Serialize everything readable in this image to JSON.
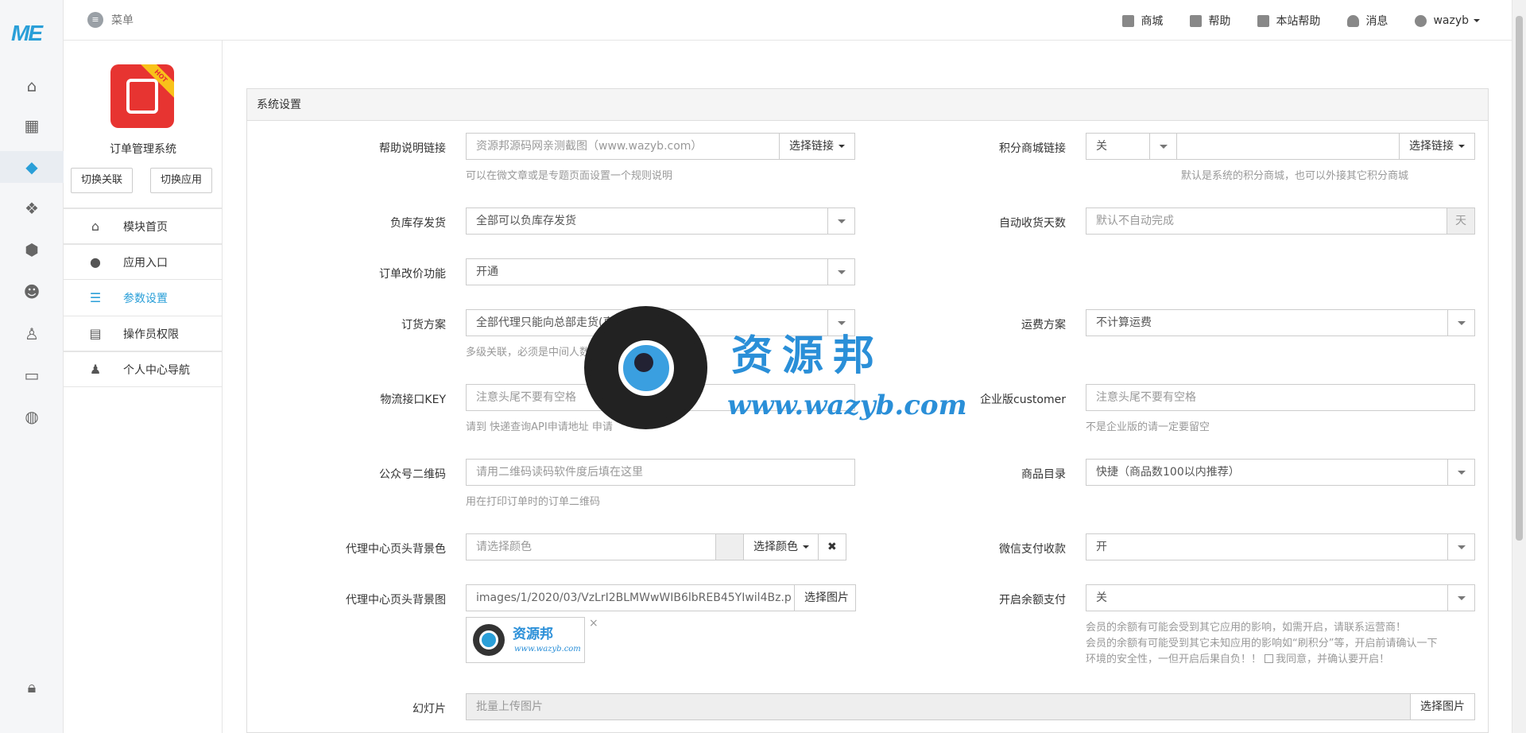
{
  "brand": {
    "logo_text": "ME"
  },
  "topbar": {
    "menu_label": "菜单",
    "links": [
      "商城",
      "帮助",
      "本站帮助",
      "消息"
    ],
    "username": "wazyb"
  },
  "sidebar": {
    "app_name": "订单管理系统",
    "ribbon": "HOT",
    "buttons": [
      "切换关联",
      "切换应用"
    ],
    "items": [
      "模块首页",
      "应用入口",
      "参数设置",
      "操作员权限",
      "个人中心导航"
    ]
  },
  "panel": {
    "title": "系统设置",
    "select_link": "选择链接",
    "select_color": "选择颜色",
    "select_image": "选择图片",
    "help_link": {
      "label": "帮助说明链接",
      "value": "资源邦源码网亲测截图（www.wazyb.com）",
      "help": "可以在微文章或是专题页面设置一个规则说明"
    },
    "points_mall": {
      "label": "积分商城链接",
      "value": "关",
      "help": "默认是系统的积分商城，也可以外接其它积分商城"
    },
    "negative_stock": {
      "label": "负库存发货",
      "value": "全部可以负库存发货"
    },
    "auto_receive": {
      "label": "自动收货天数",
      "placeholder": "默认不自动完成",
      "unit": "天"
    },
    "price_change": {
      "label": "订单改价功能",
      "value": "开通"
    },
    "order_plan": {
      "label": "订货方案",
      "value": "全部代理只能向总部走货(直接",
      "help": "多级关联，必须是中间人数据，不能"
    },
    "freight": {
      "label": "运费方案",
      "value": "不计算运费"
    },
    "logistics_key": {
      "label": "物流接口KEY",
      "placeholder": "注意头尾不要有空格",
      "help": "请到 快递查询API申请地址 申请"
    },
    "enterprise": {
      "label": "企业版customer",
      "placeholder": "注意头尾不要有空格",
      "help": "不是企业版的请一定要留空"
    },
    "qrcode": {
      "label": "公众号二维码",
      "placeholder": "请用二维码读码软件度后填在这里",
      "help": "用在打印订单时的订单二维码"
    },
    "catalog": {
      "label": "商品目录",
      "value": "快捷（商品数100以内推荐）"
    },
    "header_bg_color": {
      "label": "代理中心页头背景色",
      "placeholder": "请选择颜色",
      "clear": "✖"
    },
    "wechat_pay": {
      "label": "微信支付收款",
      "value": "开"
    },
    "header_bg_image": {
      "label": "代理中心页头背景图",
      "value": "images/1/2020/03/VzLrI2BLMWwWIB6lbREB45YIwil4Bz.p",
      "thumb_title": "资源邦",
      "thumb_url": "www.wazyb.com",
      "remove": "×"
    },
    "balance_pay": {
      "label": "开启余额支付",
      "value": "关",
      "help1": "会员的余额有可能会受到其它应用的影响，如需开启，请联系运营商！",
      "help2": "会员的余额有可能受到其它未知应用的影响如“刷积分”等，开启前请确认一下",
      "help3": "环境的安全性，一但开启后果自负！！",
      "agree": "我同意，并确认要开启！"
    },
    "slideshow": {
      "label": "幻灯片",
      "placeholder": "批量上传图片"
    }
  },
  "watermark": {
    "title": "资源邦",
    "url": "www.wazyb.com"
  },
  "colors": {
    "accent": "#2a9fd8",
    "app_icon": "#e73431"
  }
}
